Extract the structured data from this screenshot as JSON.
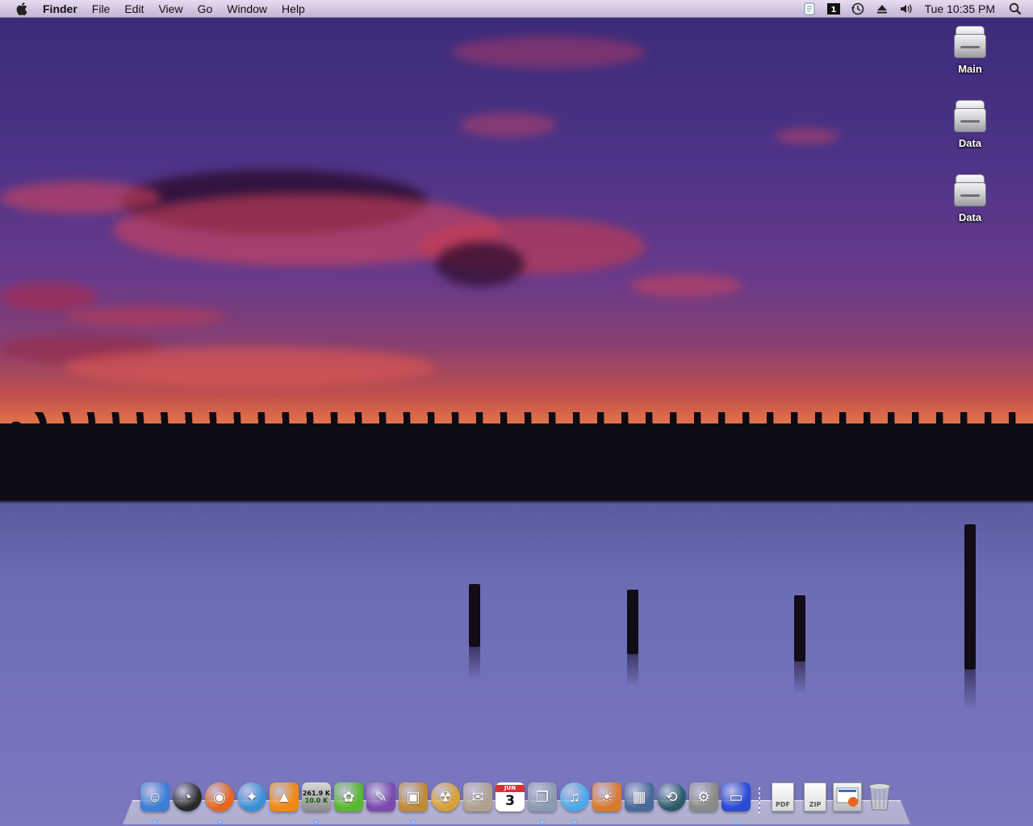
{
  "menubar": {
    "apple_icon": "apple-icon",
    "items": [
      {
        "label": "Finder",
        "bold": true
      },
      {
        "label": "File"
      },
      {
        "label": "Edit"
      },
      {
        "label": "View"
      },
      {
        "label": "Go"
      },
      {
        "label": "Window"
      },
      {
        "label": "Help"
      }
    ],
    "status_icons": [
      "script-menu-icon",
      "spaces-icon",
      "time-machine-icon",
      "eject-icon",
      "volume-icon",
      "spotlight-icon"
    ],
    "clock": "Tue 10:35 PM"
  },
  "desktop": {
    "icons": [
      {
        "label": "Main",
        "icon": "hard-drive-icon"
      },
      {
        "label": "Data",
        "icon": "hard-drive-icon"
      },
      {
        "label": "Data",
        "icon": "hard-drive-icon"
      }
    ]
  },
  "dock": {
    "apps": [
      {
        "name": "finder",
        "icon": "finder-icon",
        "running": true,
        "color": "#3b7fd6"
      },
      {
        "name": "dashboard",
        "icon": "dashboard-icon",
        "running": false,
        "color": "#2a2a2a"
      },
      {
        "name": "firefox",
        "icon": "firefox-icon",
        "running": true,
        "color": "#e8661c"
      },
      {
        "name": "safari",
        "icon": "safari-icon",
        "running": false,
        "color": "#3a8fd8"
      },
      {
        "name": "vlc",
        "icon": "vlc-icon",
        "running": false,
        "color": "#f08a10"
      },
      {
        "name": "transmission",
        "icon": "transmission-icon",
        "running": true,
        "color": "#c8c8c8",
        "badge_up": "261.9 K",
        "badge_down": "10.0 K"
      },
      {
        "name": "adium",
        "icon": "adium-icon",
        "running": false,
        "color": "#5ab830"
      },
      {
        "name": "script-editor",
        "icon": "script-editor-icon",
        "running": false,
        "color": "#7a4ab0"
      },
      {
        "name": "virtualbox",
        "icon": "virtualbox-icon",
        "running": true,
        "color": "#c08a3a"
      },
      {
        "name": "burn",
        "icon": "burn-icon",
        "running": false,
        "color": "#d8a030"
      },
      {
        "name": "mail-app",
        "icon": "stamp-icon",
        "running": false,
        "color": "#b0a090"
      },
      {
        "name": "ical",
        "icon": "calendar-icon",
        "running": false,
        "color": "#ffffff",
        "calendar_day": "3",
        "calendar_month": "JUN"
      },
      {
        "name": "preview",
        "icon": "preview-icon",
        "running": true,
        "color": "#8a9ab0"
      },
      {
        "name": "itunes",
        "icon": "itunes-icon",
        "running": true,
        "color": "#4aa8e8"
      },
      {
        "name": "iphoto",
        "icon": "iphoto-icon",
        "running": false,
        "color": "#d87a30"
      },
      {
        "name": "spaces",
        "icon": "spaces-app-icon",
        "running": false,
        "color": "#4a6a9a"
      },
      {
        "name": "time-machine",
        "icon": "time-machine-app-icon",
        "running": false,
        "color": "#2a5a6a"
      },
      {
        "name": "system-preferences",
        "icon": "system-preferences-icon",
        "running": false,
        "color": "#8a8a8a"
      },
      {
        "name": "display",
        "icon": "display-icon",
        "running": true,
        "color": "#2a4ad8"
      }
    ],
    "stacks": [
      {
        "name": "pdf-document",
        "icon": "pdf-file-icon",
        "label": "PDF"
      },
      {
        "name": "zip-archive",
        "icon": "zip-file-icon",
        "label": "ZIP"
      },
      {
        "name": "downloads",
        "icon": "downloads-stack-icon"
      }
    ],
    "trash": {
      "name": "trash",
      "icon": "trash-icon"
    }
  }
}
